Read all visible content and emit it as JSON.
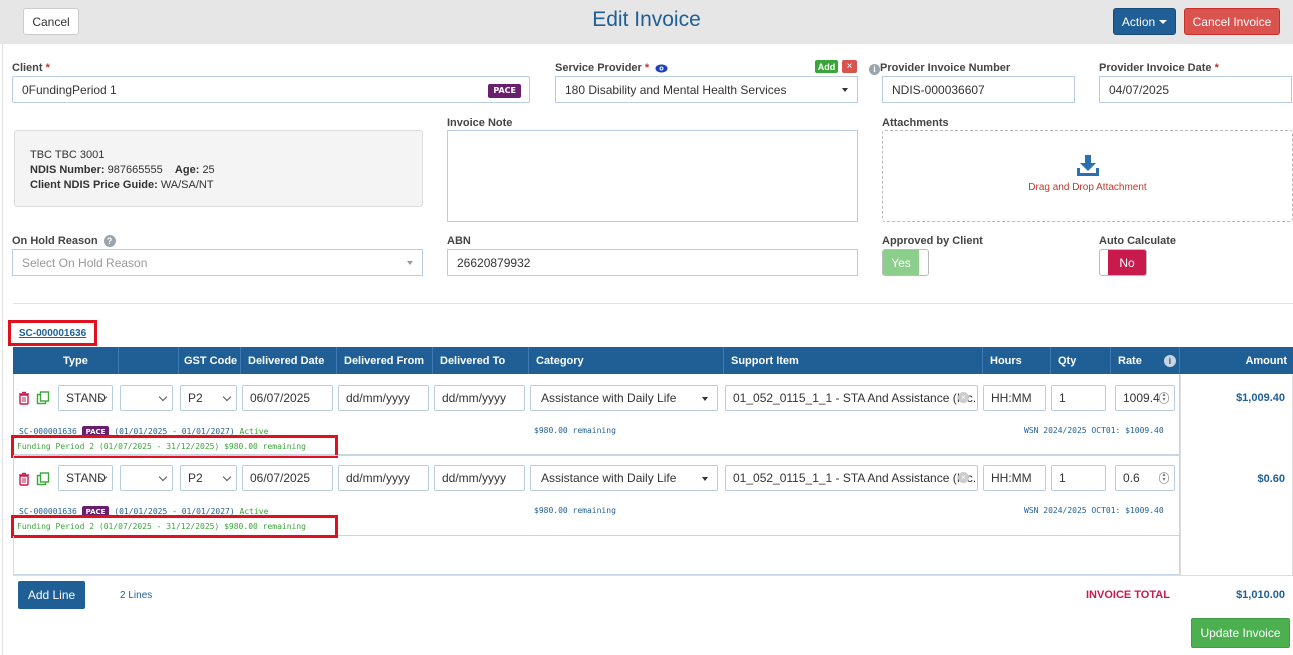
{
  "header": {
    "title": "Edit Invoice",
    "cancel_label": "Cancel",
    "action_label": "Action",
    "cancel_invoice_label": "Cancel Invoice"
  },
  "form": {
    "client_label": "Client",
    "client_value": "0FundingPeriod 1",
    "client_badge": "PACE",
    "service_provider_label": "Service Provider",
    "service_provider_add": "Add",
    "service_provider_remove": "×",
    "service_provider_value": "180 Disability and Mental Health Services",
    "provider_invoice_number_label": "Provider Invoice Number",
    "provider_invoice_number_value": "NDIS-000036607",
    "provider_invoice_date_label": "Provider Invoice Date",
    "provider_invoice_date_value": "04/07/2025",
    "client_info": {
      "name": "TBC TBC 3001",
      "ndis_label": "NDIS Number:",
      "ndis_value": "987665555",
      "age_label": "Age:",
      "age_value": "25",
      "price_guide_label": "Client NDIS Price Guide:",
      "price_guide_value": "WA/SA/NT"
    },
    "invoice_note_label": "Invoice Note",
    "invoice_note_value": "",
    "attachments_label": "Attachments",
    "attachments_dropzone_text": "Drag and Drop Attachment",
    "on_hold_reason_label": "On Hold Reason",
    "on_hold_reason_placeholder": "Select On Hold Reason",
    "abn_label": "ABN",
    "abn_value": "26620879932",
    "approved_by_client_label": "Approved by Client",
    "approved_by_client_value": "Yes",
    "auto_calculate_label": "Auto Calculate",
    "auto_calculate_value": "No"
  },
  "service_contract": "SC-000001636",
  "table": {
    "columns": [
      "Type",
      "GST Code",
      "Delivered Date",
      "Delivered From",
      "Delivered To",
      "Category",
      "Support Item",
      "Hours",
      "Qty",
      "Rate",
      "Amount"
    ],
    "rows": [
      {
        "type": "STAND",
        "blank_select": "",
        "gst_code": "P2",
        "delivered_date": "06/07/2025",
        "delivered_from_placeholder": "dd/mm/yyyy",
        "delivered_to_placeholder": "dd/mm/yyyy",
        "category": "Assistance with Daily Life",
        "support_item": "01_052_0115_1_1 - STA And Assistance (Inc.",
        "hours_placeholder": "HH:MM",
        "qty": "1",
        "rate": "1009.4",
        "amount": "$1,009.40",
        "contract_ref": "SC-000001636",
        "contract_badge": "PACE",
        "contract_period": "(01/01/2025 - 01/01/2027)",
        "contract_status": "Active",
        "funding_period": "Funding Period 2 (01/07/2025 - 31/12/2025) $980.00 remaining",
        "category_remaining": "$980.00 remaining",
        "price_ref": "WSN 2024/2025 OCT01: $1009.40"
      },
      {
        "type": "STAND",
        "blank_select": "",
        "gst_code": "P2",
        "delivered_date": "06/07/2025",
        "delivered_from_placeholder": "dd/mm/yyyy",
        "delivered_to_placeholder": "dd/mm/yyyy",
        "category": "Assistance with Daily Life",
        "support_item": "01_052_0115_1_1 - STA And Assistance (Inc.",
        "hours_placeholder": "HH:MM",
        "qty": "1",
        "rate": "0.6",
        "amount": "$0.60",
        "contract_ref": "SC-000001636",
        "contract_badge": "PACE",
        "contract_period": "(01/01/2025 - 01/01/2027)",
        "contract_status": "Active",
        "funding_period": "Funding Period 2 (01/07/2025 - 31/12/2025) $980.00 remaining",
        "category_remaining": "$980.00 remaining",
        "price_ref": "WSN 2024/2025 OCT01: $1009.40"
      }
    ]
  },
  "footer": {
    "add_line_label": "Add Line",
    "lines_count": "2",
    "lines_label": "Lines",
    "invoice_total_label": "INVOICE TOTAL",
    "invoice_total_value": "$1,010.00",
    "update_invoice_label": "Update Invoice"
  },
  "colors": {
    "primary": "#1f5f96",
    "danger": "#d9534f",
    "success": "#4cb050",
    "highlight_box": "#e0101e",
    "pace_badge": "#6a1f6e"
  },
  "icons": [
    "eye-icon",
    "info-icon",
    "download-icon",
    "question-icon",
    "trash-icon",
    "copy-icon",
    "clear-icon",
    "spinner-icon",
    "chevron-down-icon"
  ]
}
